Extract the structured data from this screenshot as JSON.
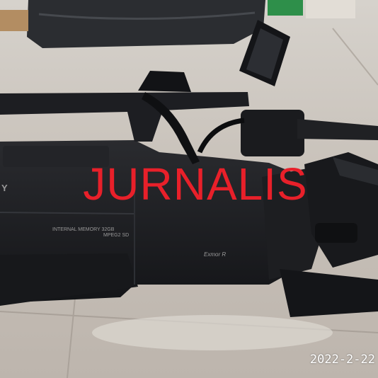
{
  "overlay": {
    "title": "JURNALIS",
    "date": "2022-2-22",
    "title_color": "#e8202a"
  },
  "camera_markings": {
    "brand_partial": "Y",
    "memory_line1": "INTERNAL MEMORY 32GB",
    "memory_line2": "MPEG2 SD",
    "sensor_badge": "Exmor R"
  },
  "colors": {
    "floor": "#c9c3bc",
    "camera_body": "#1b1c1f",
    "plastic_wrap": "#2a2c30"
  }
}
